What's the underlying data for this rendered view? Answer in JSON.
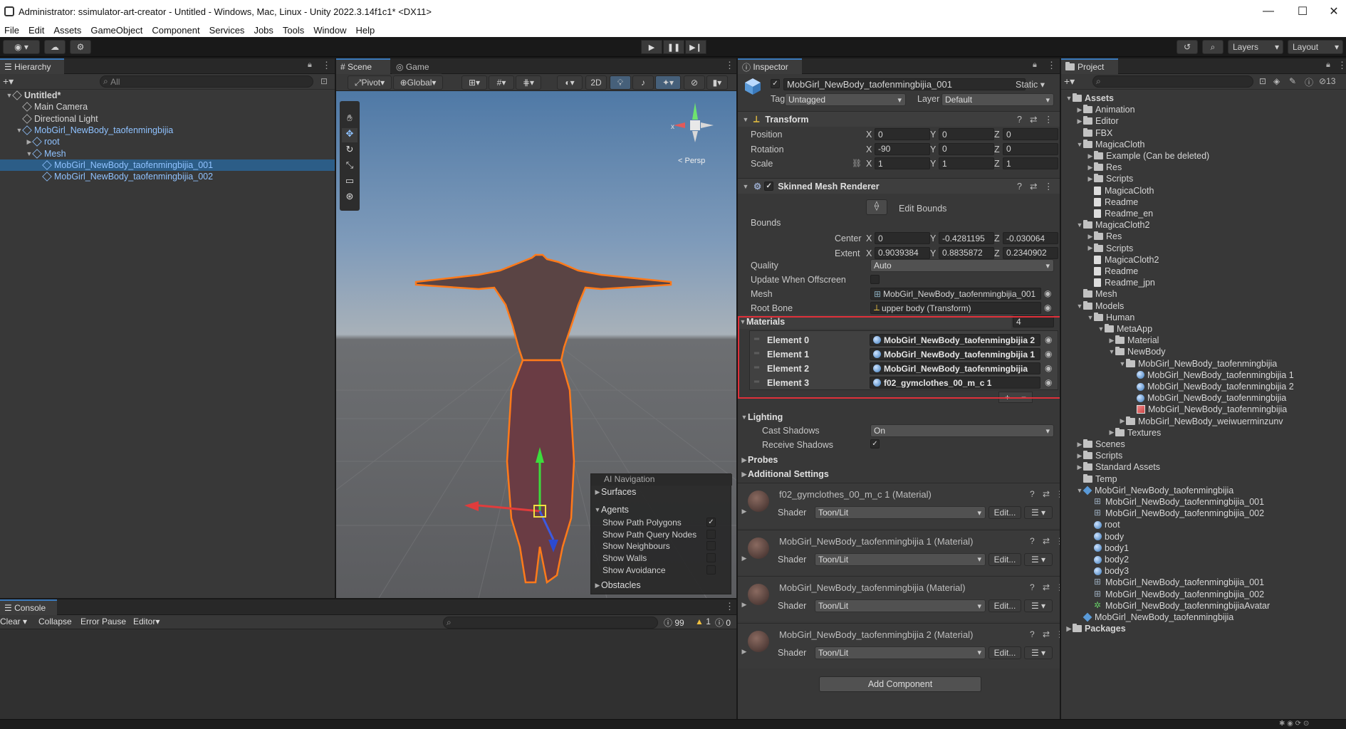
{
  "window": {
    "title": "Administrator: ssimulator-art-creator - Untitled - Windows, Mac, Linux - Unity 2022.3.14f1c1* <DX11>"
  },
  "menu": [
    "File",
    "Edit",
    "Assets",
    "GameObject",
    "Component",
    "Services",
    "Jobs",
    "Tools",
    "Window",
    "Help"
  ],
  "toolbar": {
    "layers_label": "Layers",
    "layout_label": "Layout"
  },
  "hierarchy": {
    "tab": "Hierarchy",
    "search_placeholder": "All",
    "items": [
      {
        "label": "Untitled*",
        "indent": 0
      },
      {
        "label": "Main Camera",
        "indent": 1
      },
      {
        "label": "Directional Light",
        "indent": 1
      },
      {
        "label": "MobGirl_NewBody_taofenmingbijia",
        "indent": 1
      },
      {
        "label": "root",
        "indent": 2
      },
      {
        "label": "Mesh",
        "indent": 2
      },
      {
        "label": "MobGirl_NewBody_taofenmingbijia_001",
        "indent": 3
      },
      {
        "label": "MobGirl_NewBody_taofenmingbijia_002",
        "indent": 3
      }
    ]
  },
  "scene": {
    "tab_scene": "Scene",
    "tab_game": "Game",
    "pivot": "Pivot",
    "global": "Global",
    "mode_2d": "2D",
    "persp": "< Persp",
    "gizmo_x": "x",
    "ai_nav": {
      "title": "AI Navigation",
      "surfaces": "Surfaces",
      "agents": "Agents",
      "options": [
        {
          "label": "Show Path Polygons",
          "checked": true
        },
        {
          "label": "Show Path Query Nodes",
          "checked": false
        },
        {
          "label": "Show Neighbours",
          "checked": false
        },
        {
          "label": "Show Walls",
          "checked": false
        },
        {
          "label": "Show Avoidance",
          "checked": false
        }
      ],
      "obstacles": "Obstacles"
    }
  },
  "console": {
    "tab": "Console",
    "clear": "Clear",
    "collapse": "Collapse",
    "error_pause": "Error Pause",
    "editor": "Editor",
    "count_info": "99",
    "count_warn": "1",
    "count_error": "0"
  },
  "inspector": {
    "tab": "Inspector",
    "object_name": "MobGirl_NewBody_taofenmingbijia_001",
    "static_label": "Static",
    "tag_label": "Tag",
    "tag_value": "Untagged",
    "layer_label": "Layer",
    "layer_value": "Default",
    "transform": {
      "title": "Transform",
      "position_label": "Position",
      "position": [
        "0",
        "0",
        "0"
      ],
      "rotation_label": "Rotation",
      "rotation": [
        "-90",
        "0",
        "0"
      ],
      "scale_label": "Scale",
      "scale": [
        "1",
        "1",
        "1"
      ]
    },
    "smr": {
      "title": "Skinned Mesh Renderer",
      "edit_bounds": "Edit Bounds",
      "bounds_label": "Bounds",
      "center_label": "Center",
      "center": [
        "0",
        "-0.4281195",
        "-0.030064"
      ],
      "extent_label": "Extent",
      "extent": [
        "0.9039384",
        "0.8835872",
        "0.2340902"
      ],
      "quality_label": "Quality",
      "quality": "Auto",
      "update_label": "Update When Offscreen",
      "mesh_label": "Mesh",
      "mesh": "MobGirl_NewBody_taofenmingbijia_001",
      "rootbone_label": "Root Bone",
      "rootbone": "upper body (Transform)",
      "materials_label": "Materials",
      "materials_count": "4",
      "elements": [
        {
          "label": "Element 0",
          "value": "MobGirl_NewBody_taofenmingbijia 2"
        },
        {
          "label": "Element 1",
          "value": "MobGirl_NewBody_taofenmingbijia 1"
        },
        {
          "label": "Element 2",
          "value": "MobGirl_NewBody_taofenmingbijia"
        },
        {
          "label": "Element 3",
          "value": "f02_gymclothes_00_m_c 1"
        }
      ],
      "lighting_label": "Lighting",
      "cast_shadows_label": "Cast Shadows",
      "cast_shadows": "On",
      "receive_shadows_label": "Receive Shadows",
      "probes_label": "Probes",
      "additional_label": "Additional Settings"
    },
    "material_blocks": [
      {
        "name": "f02_gymclothes_00_m_c 1 (Material)",
        "shader_label": "Shader",
        "shader": "Toon/Lit",
        "edit": "Edit..."
      },
      {
        "name": "MobGirl_NewBody_taofenmingbijia 1 (Material)",
        "shader_label": "Shader",
        "shader": "Toon/Lit",
        "edit": "Edit..."
      },
      {
        "name": "MobGirl_NewBody_taofenmingbijia (Material)",
        "shader_label": "Shader",
        "shader": "Toon/Lit",
        "edit": "Edit..."
      },
      {
        "name": "MobGirl_NewBody_taofenmingbijia 2 (Material)",
        "shader_label": "Shader",
        "shader": "Toon/Lit",
        "edit": "Edit..."
      }
    ],
    "add_component": "Add Component"
  },
  "project": {
    "tab": "Project",
    "count": "13",
    "items": [
      {
        "label": "Assets",
        "indent": 0,
        "icon": "folder",
        "bold": true
      },
      {
        "label": "Animation",
        "indent": 1,
        "icon": "folder"
      },
      {
        "label": "Editor",
        "indent": 1,
        "icon": "folder"
      },
      {
        "label": "FBX",
        "indent": 1,
        "icon": "folder"
      },
      {
        "label": "MagicaCloth",
        "indent": 1,
        "icon": "folder"
      },
      {
        "label": "Example (Can be deleted)",
        "indent": 2,
        "icon": "folder"
      },
      {
        "label": "Res",
        "indent": 2,
        "icon": "folder"
      },
      {
        "label": "Scripts",
        "indent": 2,
        "icon": "folder"
      },
      {
        "label": "MagicaCloth",
        "indent": 2,
        "icon": "file"
      },
      {
        "label": "Readme",
        "indent": 2,
        "icon": "file"
      },
      {
        "label": "Readme_en",
        "indent": 2,
        "icon": "file"
      },
      {
        "label": "MagicaCloth2",
        "indent": 1,
        "icon": "folder"
      },
      {
        "label": "Res",
        "indent": 2,
        "icon": "folder"
      },
      {
        "label": "Scripts",
        "indent": 2,
        "icon": "folder"
      },
      {
        "label": "MagicaCloth2",
        "indent": 2,
        "icon": "file"
      },
      {
        "label": "Readme",
        "indent": 2,
        "icon": "file"
      },
      {
        "label": "Readme_jpn",
        "indent": 2,
        "icon": "file"
      },
      {
        "label": "Mesh",
        "indent": 1,
        "icon": "folder"
      },
      {
        "label": "Models",
        "indent": 1,
        "icon": "folder"
      },
      {
        "label": "Human",
        "indent": 2,
        "icon": "folder"
      },
      {
        "label": "MetaApp",
        "indent": 3,
        "icon": "folder"
      },
      {
        "label": "Material",
        "indent": 4,
        "icon": "folder"
      },
      {
        "label": "NewBody",
        "indent": 4,
        "icon": "folder"
      },
      {
        "label": "MobGirl_NewBody_taofenmingbijia",
        "indent": 5,
        "icon": "folder"
      },
      {
        "label": "MobGirl_NewBody_taofenmingbijia 1",
        "indent": 6,
        "icon": "ball"
      },
      {
        "label": "MobGirl_NewBody_taofenmingbijia 2",
        "indent": 6,
        "icon": "ball"
      },
      {
        "label": "MobGirl_NewBody_taofenmingbijia",
        "indent": 6,
        "icon": "ball"
      },
      {
        "label": "MobGirl_NewBody_taofenmingbijia",
        "indent": 6,
        "icon": "texture"
      },
      {
        "label": "MobGirl_NewBody_weiwuerminzunv",
        "indent": 5,
        "icon": "folder"
      },
      {
        "label": "Textures",
        "indent": 4,
        "icon": "folder"
      },
      {
        "label": "Scenes",
        "indent": 1,
        "icon": "folder"
      },
      {
        "label": "Scripts",
        "indent": 1,
        "icon": "folder"
      },
      {
        "label": "Standard Assets",
        "indent": 1,
        "icon": "folder"
      },
      {
        "label": "Temp",
        "indent": 1,
        "icon": "folder"
      },
      {
        "label": "MobGirl_NewBody_taofenmingbijia",
        "indent": 1,
        "icon": "cube"
      },
      {
        "label": "MobGirl_NewBody_taofenmingbijia_001",
        "indent": 2,
        "icon": "grid"
      },
      {
        "label": "MobGirl_NewBody_taofenmingbijia_002",
        "indent": 2,
        "icon": "grid"
      },
      {
        "label": "root",
        "indent": 2,
        "icon": "ball"
      },
      {
        "label": "body",
        "indent": 2,
        "icon": "ball"
      },
      {
        "label": "body1",
        "indent": 2,
        "icon": "ball"
      },
      {
        "label": "body2",
        "indent": 2,
        "icon": "ball"
      },
      {
        "label": "body3",
        "indent": 2,
        "icon": "ball"
      },
      {
        "label": "MobGirl_NewBody_taofenmingbijia_001",
        "indent": 2,
        "icon": "grid"
      },
      {
        "label": "MobGirl_NewBody_taofenmingbijia_002",
        "indent": 2,
        "icon": "grid"
      },
      {
        "label": "MobGirl_NewBody_taofenmingbijiaAvatar",
        "indent": 2,
        "icon": "avatar"
      },
      {
        "label": "MobGirl_NewBody_taofenmingbijia",
        "indent": 1,
        "icon": "cube"
      },
      {
        "label": "Packages",
        "indent": 0,
        "icon": "folder",
        "bold": true
      }
    ]
  },
  "colors": {
    "accent": "#3a79bb",
    "selection": "#2c5d87",
    "highlight_box": "#e0303a",
    "outline": "#ff7a1a"
  }
}
